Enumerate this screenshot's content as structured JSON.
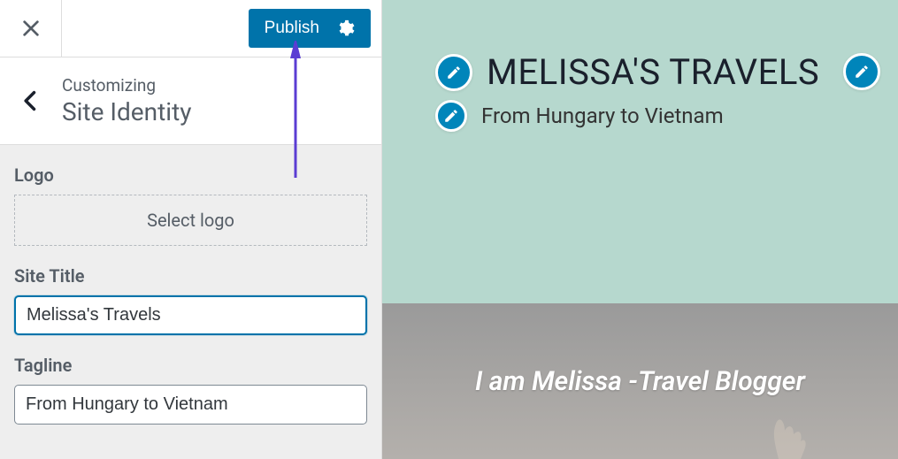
{
  "topbar": {
    "publish_label": "Publish"
  },
  "section": {
    "kicker": "Customizing",
    "title": "Site Identity"
  },
  "fields": {
    "logo_label": "Logo",
    "select_logo": "Select logo",
    "site_title_label": "Site Title",
    "site_title_value": "Melissa's Travels",
    "tagline_label": "Tagline",
    "tagline_value": "From Hungary to Vietnam"
  },
  "preview": {
    "site_title": "MELISSA'S TRAVELS",
    "tagline": "From Hungary to Vietnam",
    "banner_text": "I am Melissa -Travel Blogger"
  },
  "colors": {
    "accent": "#0073aa",
    "hero_bg": "#b6d8ce",
    "arrow": "#5b3dd3"
  }
}
